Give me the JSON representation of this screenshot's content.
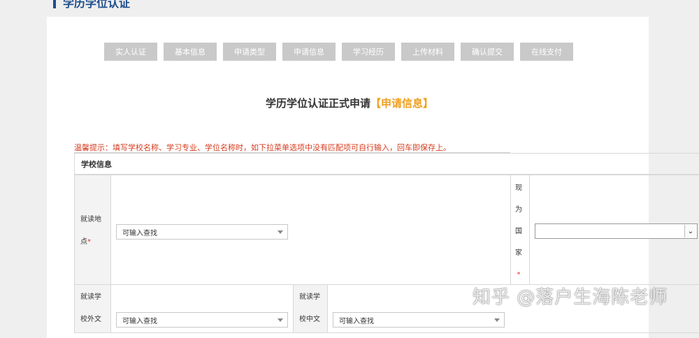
{
  "section": {
    "title": "学历学位认证"
  },
  "steps": [
    "实人认证",
    "基本信息",
    "申请类型",
    "申请信息",
    "学习经历",
    "上传材料",
    "确认提交",
    "在线支付"
  ],
  "form": {
    "title": "学历学位认证正式申请",
    "title_highlight": "【申请信息】",
    "tip": "温馨提示：填写学校名称、学习专业、学位名称时，如下拉菜单选项中没有匹配项可自行输入，回车即保存上。",
    "school_section": "学校信息",
    "study_location": {
      "label_line1": "就读地",
      "label_line2": "点",
      "required_mark": "*",
      "placeholder": "可输入查找"
    },
    "current_country": {
      "chars": [
        "现",
        "为",
        "国",
        "家"
      ],
      "required_mark": "*",
      "value": ""
    },
    "school_foreign": {
      "label_line1": "就读学",
      "label_line2": "校外文",
      "placeholder": "可输入查找"
    },
    "school_chinese": {
      "label_line1": "就读学",
      "label_line2": "校中文",
      "placeholder": "可输入查找"
    }
  },
  "watermark": "知乎 @落户生海陈老师",
  "colors": {
    "accent": "#f0a020",
    "warning": "#d63c1f",
    "step_bg": "#c9c9c9"
  }
}
